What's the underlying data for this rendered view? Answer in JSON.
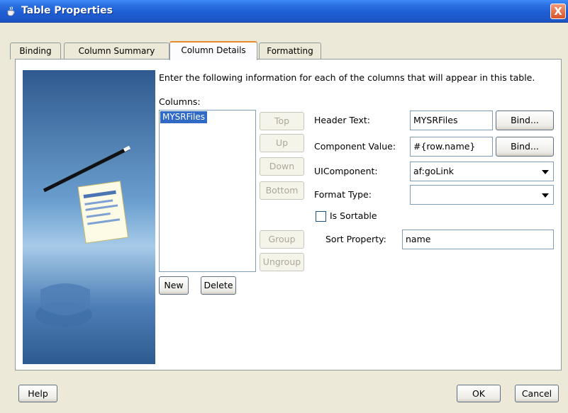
{
  "window": {
    "title": "Table Properties",
    "close_glyph": "X"
  },
  "tabs": [
    {
      "label": "Binding",
      "active": false
    },
    {
      "label": "Column Summary",
      "active": false
    },
    {
      "label": "Column Details",
      "active": true
    },
    {
      "label": "Formatting",
      "active": false
    }
  ],
  "content": {
    "instructions": "Enter the following information for each of the columns that will appear in this table.",
    "columns_label": "Columns:",
    "columns": [
      "MYSRFiles"
    ],
    "selected_column": "MYSRFiles"
  },
  "move_buttons": {
    "top": "Top",
    "up": "Up",
    "down": "Down",
    "bottom": "Bottom",
    "group": "Group",
    "ungroup": "Ungroup"
  },
  "list_buttons": {
    "new": "New",
    "delete": "Delete"
  },
  "form": {
    "header_text_label": "Header Text:",
    "header_text_value": "MYSRFiles",
    "component_value_label": "Component Value:",
    "component_value_value": "#{row.name}",
    "bind_label": "Bind...",
    "uicomponent_label": "UIComponent:",
    "uicomponent_value": "af:goLink",
    "format_type_label": "Format Type:",
    "format_type_value": "",
    "is_sortable_label": "Is Sortable",
    "is_sortable_checked": false,
    "sort_property_label": "Sort Property:",
    "sort_property_value": "name"
  },
  "footer": {
    "help": "Help",
    "ok": "OK",
    "cancel": "Cancel"
  },
  "colors": {
    "title_bar": "#1f5fd4",
    "selection": "#316ac5",
    "active_tab_accent": "#e68b2c"
  }
}
